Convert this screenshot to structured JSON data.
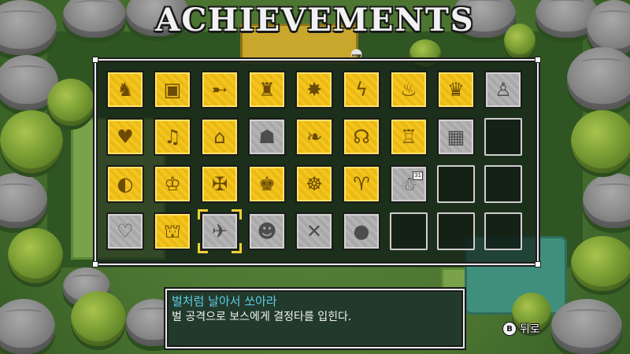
{
  "title": "ACHIEVEMENTS",
  "colors": {
    "unlocked": "#f3c51e",
    "locked": "#b4b4b4",
    "selection": "#f4cf3a",
    "achievement_name": "#5fcde4"
  },
  "achievements": [
    {
      "state": "unlocked",
      "icon": "knight-icon"
    },
    {
      "state": "unlocked",
      "icon": "treasure-chest-icon"
    },
    {
      "state": "unlocked",
      "icon": "sword-thrust-icon"
    },
    {
      "state": "unlocked",
      "icon": "warrior-icon"
    },
    {
      "state": "unlocked",
      "icon": "explosion-icon"
    },
    {
      "state": "unlocked",
      "icon": "lightning-icon"
    },
    {
      "state": "unlocked",
      "icon": "flame-icon"
    },
    {
      "state": "unlocked",
      "icon": "crab-boss-icon"
    },
    {
      "state": "locked",
      "icon": "dancer-icon"
    },
    {
      "state": "unlocked",
      "icon": "heart-icon"
    },
    {
      "state": "unlocked",
      "icon": "music-player-icon"
    },
    {
      "state": "unlocked",
      "icon": "shop-icon"
    },
    {
      "state": "locked",
      "icon": "villagers-icon"
    },
    {
      "state": "unlocked",
      "icon": "fish-icon"
    },
    {
      "state": "unlocked",
      "icon": "alien-icon"
    },
    {
      "state": "unlocked",
      "icon": "crowd-icon"
    },
    {
      "state": "locked",
      "icon": "market-icon"
    },
    {
      "state": "empty"
    },
    {
      "state": "unlocked",
      "icon": "sound-icon"
    },
    {
      "state": "unlocked",
      "icon": "hero-icon"
    },
    {
      "state": "unlocked",
      "icon": "winged-knight-icon"
    },
    {
      "state": "unlocked",
      "icon": "demon-boss-icon"
    },
    {
      "state": "unlocked",
      "icon": "golem-boss-icon"
    },
    {
      "state": "unlocked",
      "icon": "ram-icon"
    },
    {
      "state": "locked",
      "icon": "calendar-icon",
      "badge": "31"
    },
    {
      "state": "empty"
    },
    {
      "state": "empty"
    },
    {
      "state": "locked",
      "icon": "hearts-icon"
    },
    {
      "state": "unlocked",
      "icon": "shrine-icon"
    },
    {
      "state": "locked",
      "icon": "flying-strike-icon",
      "selected": true
    },
    {
      "state": "locked",
      "icon": "bear-icon"
    },
    {
      "state": "locked",
      "icon": "mute-icon"
    },
    {
      "state": "locked",
      "icon": "bomb-icon"
    },
    {
      "state": "empty"
    },
    {
      "state": "empty"
    },
    {
      "state": "empty"
    }
  ],
  "selected": {
    "name": "벌처럼 날아서 쏘아라",
    "description": "벌 공격으로 보스에게 결정타를 입힌다."
  },
  "back": {
    "button": "B",
    "label": "뒤로"
  }
}
